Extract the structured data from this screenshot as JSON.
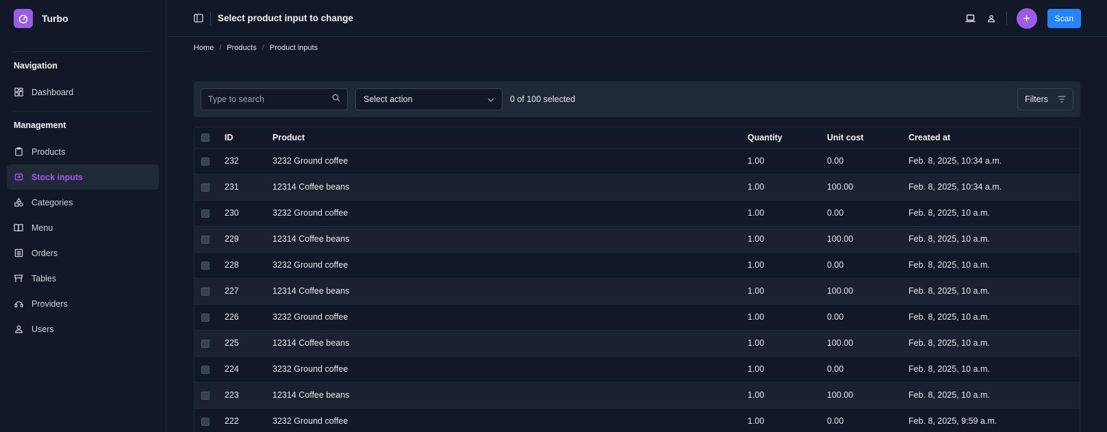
{
  "app": {
    "name": "Turbo",
    "logo_icon": "gauge-icon",
    "accent": "#9b5de5"
  },
  "sidebar": {
    "sections": [
      {
        "title": "Navigation",
        "items": [
          {
            "label": "Dashboard",
            "icon": "dashboard-icon"
          }
        ]
      },
      {
        "title": "Management",
        "items": [
          {
            "label": "Products",
            "icon": "clipboard-icon"
          },
          {
            "label": "Stock inputs",
            "icon": "login-icon",
            "active": true
          },
          {
            "label": "Categories",
            "icon": "shapes-icon"
          },
          {
            "label": "Menu",
            "icon": "book-icon"
          },
          {
            "label": "Orders",
            "icon": "list-icon"
          },
          {
            "label": "Tables",
            "icon": "table-icon"
          },
          {
            "label": "Providers",
            "icon": "support-icon"
          },
          {
            "label": "Users",
            "icon": "person-icon"
          }
        ]
      }
    ]
  },
  "header": {
    "title": "Select product input to change",
    "scan_label": "Scan",
    "plus_label": "+",
    "scan_color": "#2684ff"
  },
  "breadcrumb": [
    "Home",
    "Products",
    "Product inputs"
  ],
  "toolbar": {
    "search_placeholder": "Type to search",
    "action_label": "Select action",
    "selected_text": "0 of 100 selected",
    "filters_label": "Filters"
  },
  "table": {
    "columns": [
      "ID",
      "Product",
      "Quantity",
      "Unit cost",
      "Created at"
    ],
    "rows": [
      [
        "232",
        "3232 Ground coffee",
        "1.00",
        "0.00",
        "Feb. 8, 2025, 10:34 a.m."
      ],
      [
        "231",
        "12314 Coffee beans",
        "1.00",
        "100.00",
        "Feb. 8, 2025, 10:34 a.m."
      ],
      [
        "230",
        "3232 Ground coffee",
        "1.00",
        "0.00",
        "Feb. 8, 2025, 10 a.m."
      ],
      [
        "229",
        "12314 Coffee beans",
        "1.00",
        "100.00",
        "Feb. 8, 2025, 10 a.m."
      ],
      [
        "228",
        "3232 Ground coffee",
        "1.00",
        "0.00",
        "Feb. 8, 2025, 10 a.m."
      ],
      [
        "227",
        "12314 Coffee beans",
        "1.00",
        "100.00",
        "Feb. 8, 2025, 10 a.m."
      ],
      [
        "226",
        "3232 Ground coffee",
        "1.00",
        "0.00",
        "Feb. 8, 2025, 10 a.m."
      ],
      [
        "225",
        "12314 Coffee beans",
        "1.00",
        "100.00",
        "Feb. 8, 2025, 10 a.m."
      ],
      [
        "224",
        "3232 Ground coffee",
        "1.00",
        "0.00",
        "Feb. 8, 2025, 10 a.m."
      ],
      [
        "223",
        "12314 Coffee beans",
        "1.00",
        "100.00",
        "Feb. 8, 2025, 10 a.m."
      ],
      [
        "222",
        "3232 Ground coffee",
        "1.00",
        "0.00",
        "Feb. 8, 2025, 9:59 a.m."
      ]
    ]
  }
}
